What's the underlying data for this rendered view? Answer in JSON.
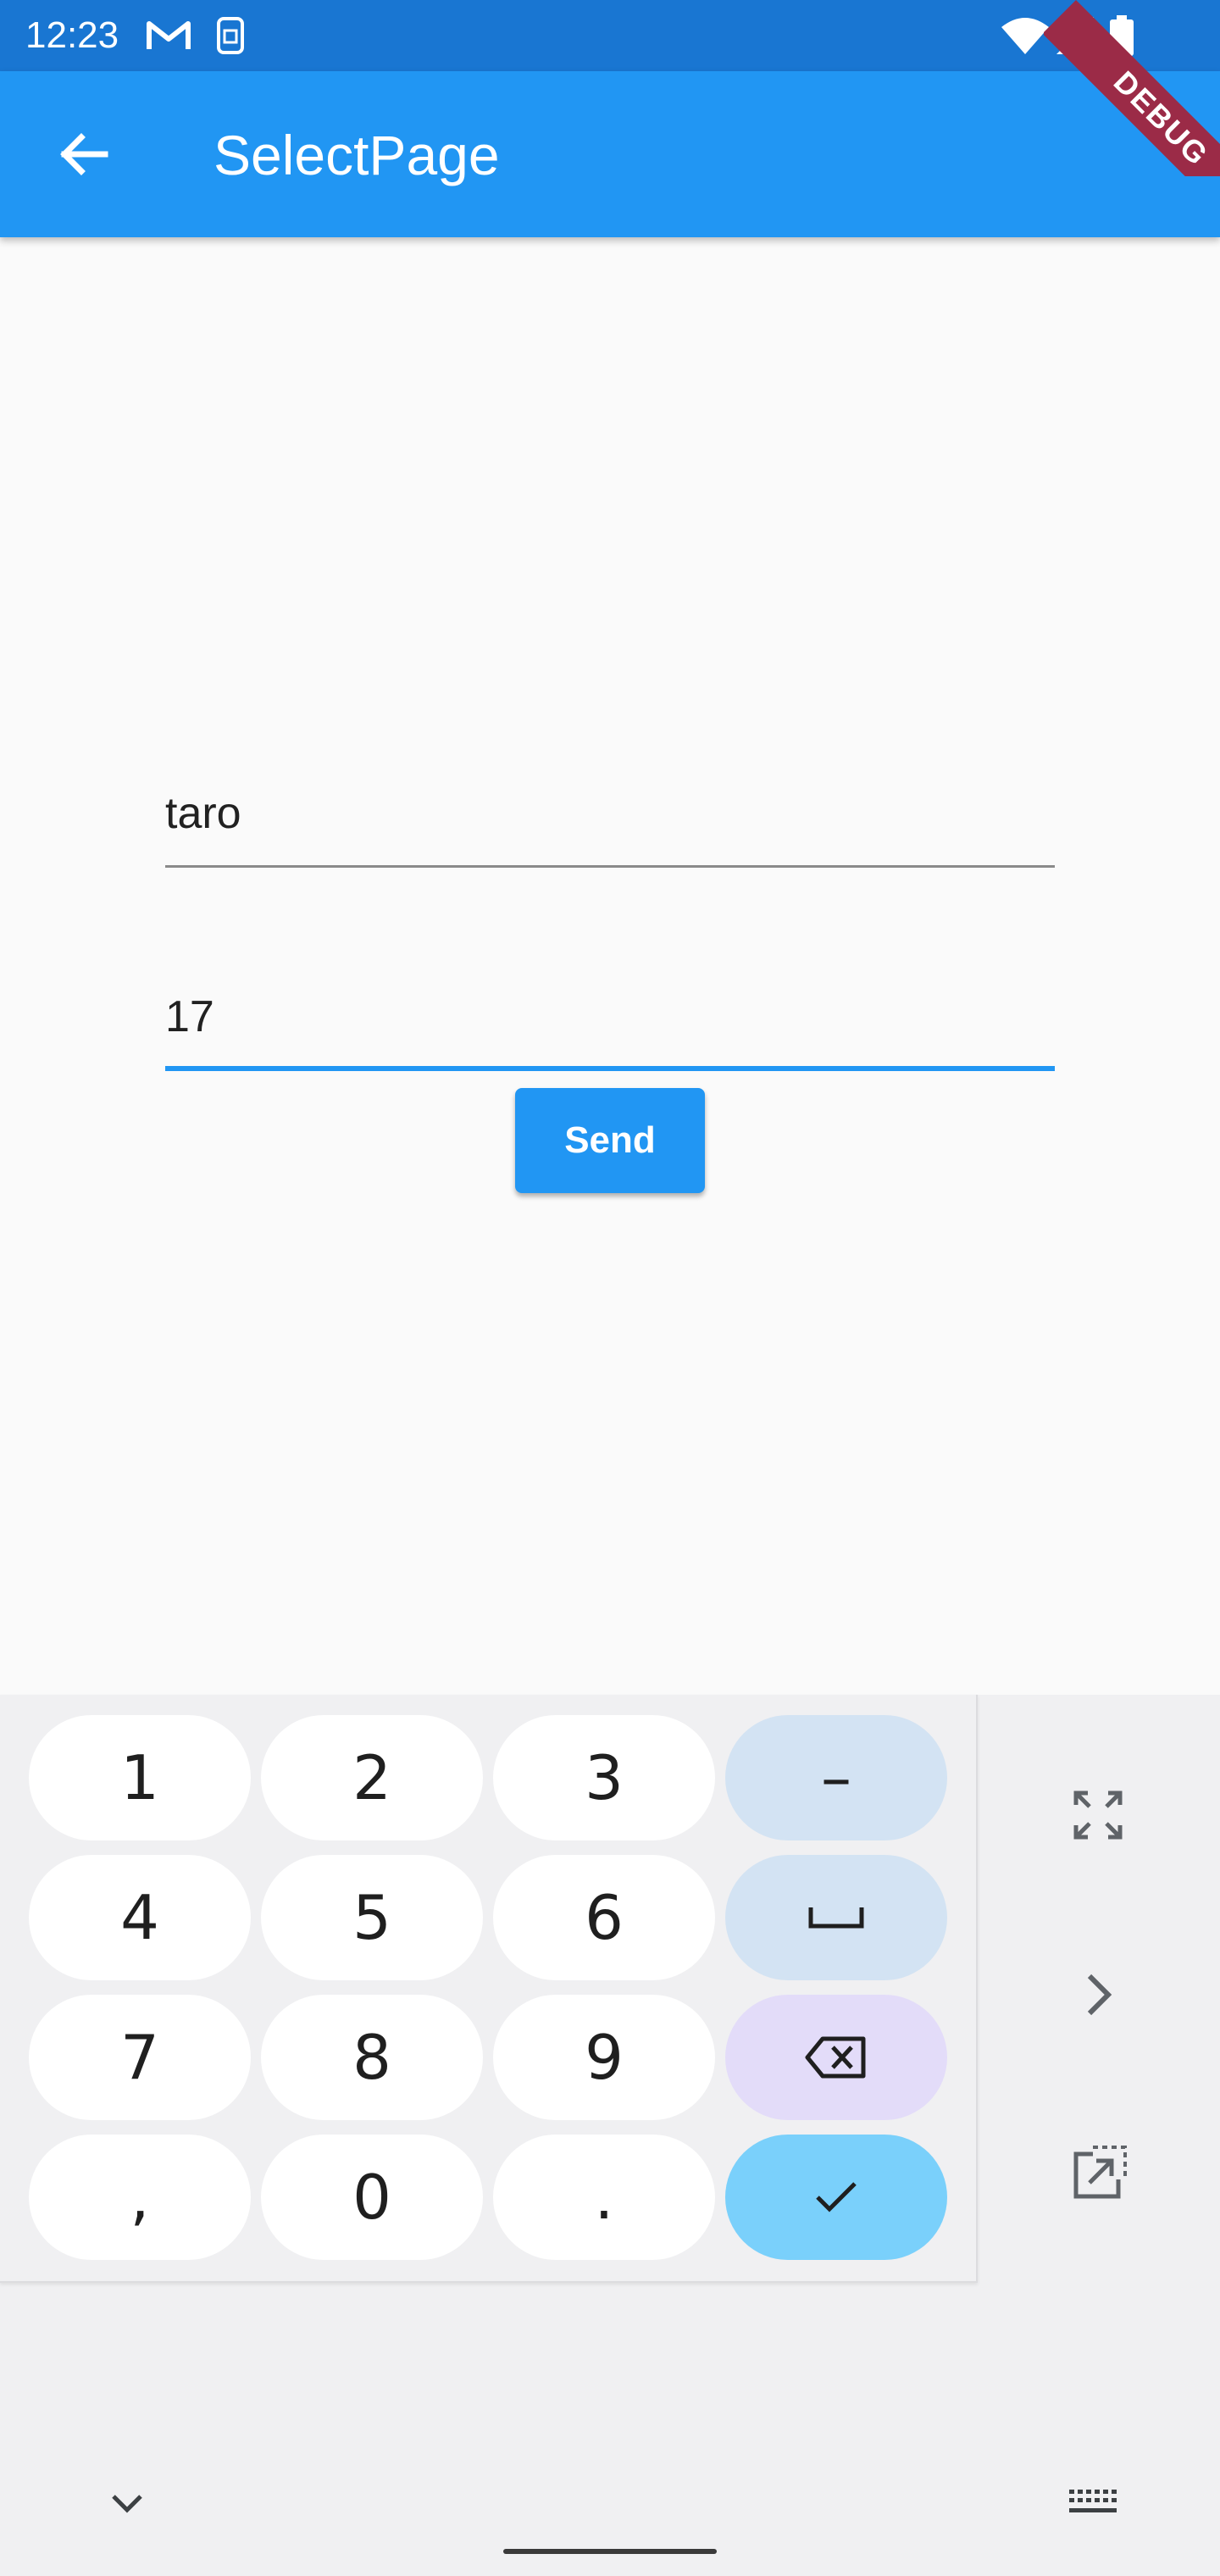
{
  "status_bar": {
    "time": "12:23",
    "icons": [
      "gmail-icon",
      "sim-icon",
      "wifi-icon",
      "signal-icon",
      "battery-icon"
    ]
  },
  "app_bar": {
    "title": "SelectPage",
    "back_icon": "arrow-back-icon",
    "background": "#2196f3"
  },
  "debug_banner": {
    "label": "DEBUG"
  },
  "form": {
    "name_value": "taro",
    "age_value": "17",
    "send_label": "Send"
  },
  "keyboard": {
    "keys": [
      {
        "label": "1",
        "kind": "digit"
      },
      {
        "label": "2",
        "kind": "digit"
      },
      {
        "label": "3",
        "kind": "digit"
      },
      {
        "label": "–",
        "kind": "op"
      },
      {
        "label": "4",
        "kind": "digit"
      },
      {
        "label": "5",
        "kind": "digit"
      },
      {
        "label": "6",
        "kind": "digit"
      },
      {
        "label": "␣",
        "kind": "op"
      },
      {
        "label": "7",
        "kind": "digit"
      },
      {
        "label": "8",
        "kind": "digit"
      },
      {
        "label": "9",
        "kind": "digit"
      },
      {
        "label": "",
        "kind": "backspace"
      },
      {
        "label": ",",
        "kind": "digit"
      },
      {
        "label": "0",
        "kind": "digit"
      },
      {
        "label": ".",
        "kind": "digit"
      },
      {
        "label": "",
        "kind": "enter"
      }
    ],
    "side_icons": [
      "fullscreen-icon",
      "chevron-right-icon",
      "open-external-icon"
    ],
    "bottom_icons": [
      "chevron-down-icon",
      "keyboard-icon"
    ]
  },
  "colors": {
    "primary": "#2196f3",
    "status_bar": "#1976d2",
    "debug_ribbon": "#9b2b47",
    "key_op": "#d3e3f3",
    "key_delete": "#e3dcf9",
    "key_enter": "#7ad0fb"
  }
}
